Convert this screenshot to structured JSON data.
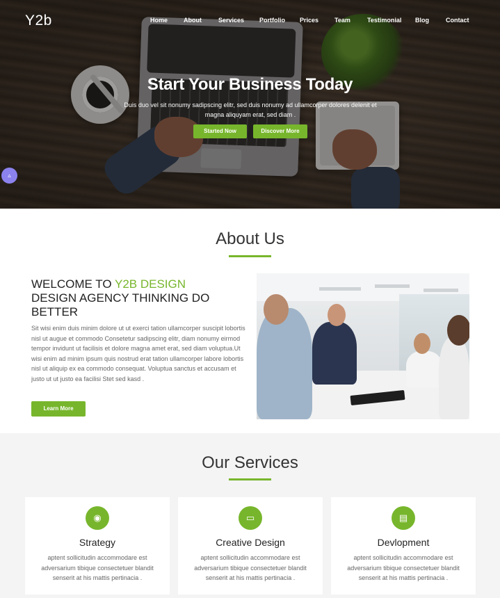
{
  "brand": {
    "logo": "Y2b",
    "accent_color": "#77b62c"
  },
  "nav": {
    "items": [
      "Home",
      "About",
      "Services",
      "Portfolio",
      "Prices",
      "Team",
      "Testimonial",
      "Blog",
      "Contact"
    ]
  },
  "hero": {
    "title": "Start Your Business Today",
    "subtitle": "Duis duo vel sit nonumy sadipscing elitr, sed duis nonumy ad ullamcorper dolores delenit et magna aliquyam erat, sed diam .",
    "button_primary": "Started Now",
    "button_secondary": "Discover More",
    "fab_icon": "up-arrow-icon",
    "fab_glyph": "▵"
  },
  "about": {
    "section_title": "About Us",
    "welcome_prefix": "WELCOME TO ",
    "welcome_accent": "Y2B DESIGN",
    "welcome_rest": "DESIGN AGENCY THINKING DO BETTER",
    "body": "Sit wisi enim duis minim dolore ut ut exerci tation ullamcorper suscipit lobortis nisl ut augue et commodo Consetetur sadipscing elitr, diam nonumy eirmod tempor invidunt ut facilisis et dolore magna amet erat, sed diam voluptua.Ut wisi enim ad minim ipsum quis nostrud erat tation ullamcorper labore lobortis nisl ut aliquip ex ea commodo consequat. Voluptua sanctus et accusam et justo ut ut justo ea facilisi Stet sed kasd .",
    "learn_more": "Learn More"
  },
  "services": {
    "section_title": "Our Services",
    "cards": [
      {
        "icon": "camera-icon",
        "glyph": "◉",
        "title": "Strategy",
        "text": "aptent sollicitudin accommodare est adversarium tibique consectetuer blandit senserit at his mattis pertinacia ."
      },
      {
        "icon": "laptop-icon",
        "glyph": "▭",
        "title": "Creative Design",
        "text": "aptent sollicitudin accommodare est adversarium tibique consectetuer blandit senserit at his mattis pertinacia ."
      },
      {
        "icon": "document-icon",
        "glyph": "▤",
        "title": "Devlopment",
        "text": "aptent sollicitudin accommodare est adversarium tibique consectetuer blandit senserit at his mattis pertinacia ."
      }
    ]
  }
}
